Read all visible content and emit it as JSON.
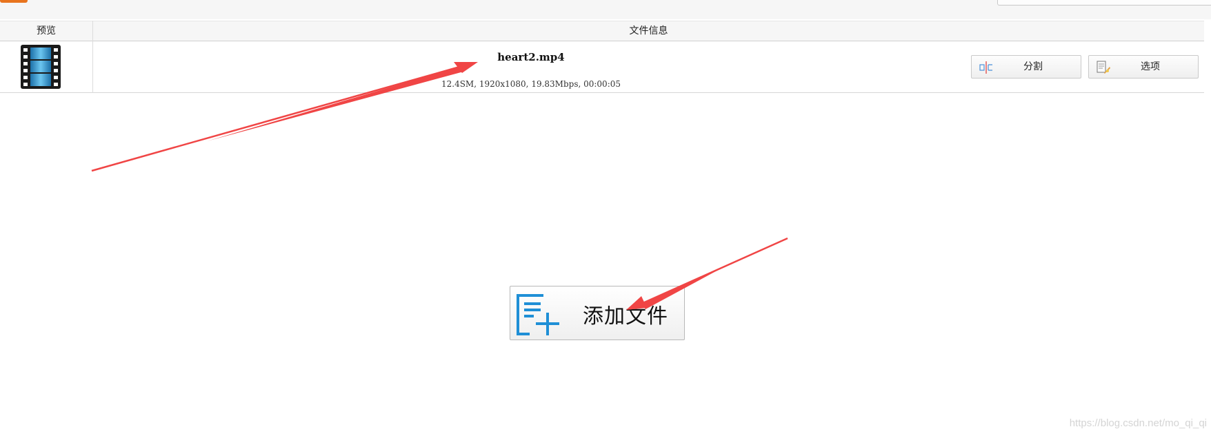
{
  "table": {
    "headers": {
      "preview": "预览",
      "file_info": "文件信息"
    },
    "rows": [
      {
        "file_name": "heart2.mp4",
        "meta": "12.4SM, 1920x1080, 19.83Mbps, 00:00:05",
        "split_label": "分割",
        "options_label": "选项"
      }
    ]
  },
  "add_file_label": "添加文件",
  "watermark": "https://blog.csdn.net/mo_qi_qi",
  "colors": {
    "annotation_arrow": "#f04545",
    "accent_blue": "#1f8fd6",
    "logo_orange": "#e8741e"
  },
  "icons": {
    "preview": "film-strip-icon",
    "split": "split-icon",
    "options": "options-icon",
    "add_file": "add-file-icon"
  }
}
